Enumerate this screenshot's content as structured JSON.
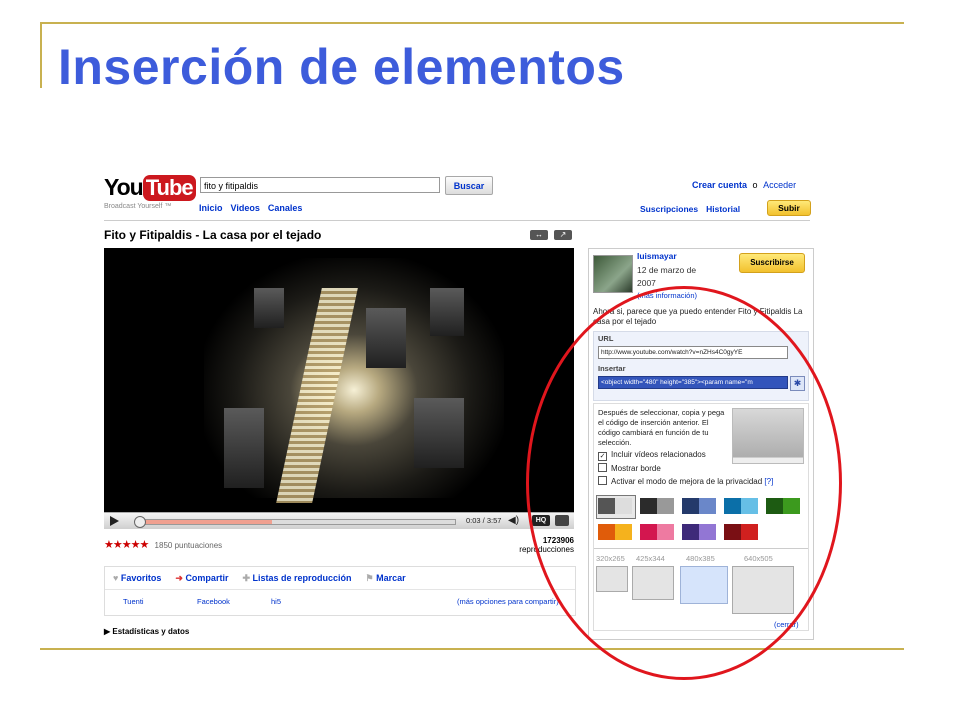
{
  "slide": {
    "title": "Inserción de elementos"
  },
  "header": {
    "logo_you": "You",
    "logo_tube": "Tube",
    "tagline": "Broadcast Yourself ™",
    "search_value": "fito y fitipaldis",
    "search_button": "Buscar",
    "nav": [
      "Inicio",
      "Videos",
      "Canales"
    ],
    "create_account": "Crear cuenta",
    "or": "o",
    "sign_in": "Acceder",
    "subscriptions": "Suscripciones",
    "history": "Historial",
    "upload": "Subir"
  },
  "video": {
    "title": "Fito y Fitipaldis - La casa por el tejado",
    "time": "0:03 / 3:57",
    "progress": 0.42,
    "hq_label": "HQ",
    "rating_stars": "★★★★★",
    "ratings": "1850 puntuaciones",
    "views_count": "1723906",
    "views_label": "reproducciones",
    "actions": [
      "Favoritos",
      "Compartir",
      "Listas de reproducción",
      "Marcar"
    ],
    "action_icons": [
      "♥",
      "➜",
      "✚",
      "⚑"
    ],
    "share": [
      "Tuenti",
      "Facebook",
      "hi5"
    ],
    "more_share": "(más opciones para compartir)",
    "stats": "Estadísticas y datos"
  },
  "side": {
    "user": "luismayar",
    "date": "12 de marzo de 2007",
    "more_info": "(más información)",
    "subscribe": "Suscribirse",
    "description": "Ahora si, parece que ya puedo entender Fito y Fitipaldis La casa por el tejado",
    "url_label": "URL",
    "url_value": "http://www.youtube.com/watch?v=nZHs4C0gyYE",
    "embed_label": "Insertar",
    "embed_value": "<object width=\"480\" height=\"385\"><param name=\"m",
    "custom_text": "Después de seleccionar, copia y pega el código de inserción anterior. El código cambiará en función de tu selección.",
    "opt_related": "Incluir vídeos relacionados",
    "opt_border": "Mostrar borde",
    "opt_privacy": "Activar el modo de mejora de la privacidad",
    "opt_help": "[?]",
    "opt_related_checked": true,
    "sizes": [
      "320x265",
      "425x344",
      "480x385",
      "640x505"
    ],
    "close": "(cerrar)",
    "swatch_colors": [
      [
        "#555555",
        "#dddddd"
      ],
      [
        "#2b2b2b",
        "#999999"
      ],
      [
        "#243a6b",
        "#6a87c9"
      ],
      [
        "#0b6fa8",
        "#66bfe6"
      ],
      [
        "#1d5b12",
        "#3c9a1e"
      ],
      [
        "#e05c0a",
        "#f5b21d"
      ],
      [
        "#d3164f",
        "#ee7aa1"
      ],
      [
        "#3e2a7a",
        "#9276d4"
      ],
      [
        "#7a0f14",
        "#d0201f"
      ]
    ]
  },
  "colors": {
    "title": "#3d5cdb",
    "rule": "#c8b150",
    "ellipse": "#e0161d",
    "link": "#0033cc"
  }
}
